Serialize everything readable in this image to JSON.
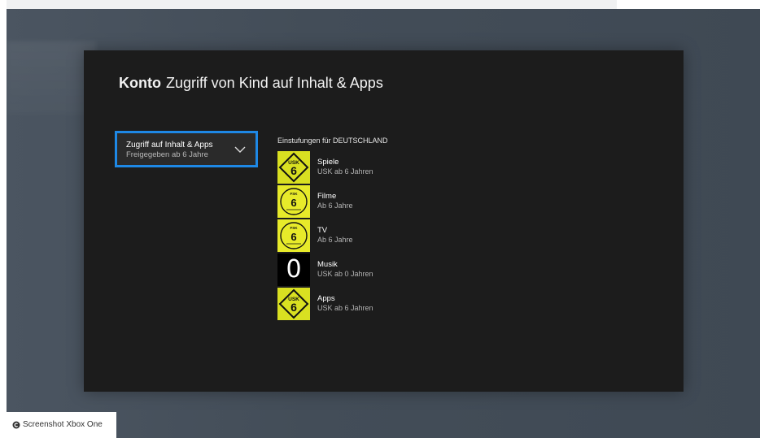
{
  "header": {
    "section": "Konto",
    "page_title": "Zugriff von Kind auf Inhalt & Apps"
  },
  "access_dropdown": {
    "label": "Zugriff auf Inhalt & Apps",
    "value": "Freigegeben ab 6 Jahre",
    "icon": "chevron-down-icon"
  },
  "ratings": {
    "heading": "Einstufungen für DEUTSCHLAND",
    "items": [
      {
        "category": "Spiele",
        "rating": "USK ab 6 Jahren",
        "badge": "usk",
        "badge_text": "USK",
        "badge_number": "6"
      },
      {
        "category": "Filme",
        "rating": "Ab 6 Jahre",
        "badge": "fsk",
        "badge_text": "FSK",
        "badge_number": "6"
      },
      {
        "category": "TV",
        "rating": "Ab 6 Jahre",
        "badge": "fsk",
        "badge_text": "FSK",
        "badge_number": "6"
      },
      {
        "category": "Musik",
        "rating": "USK ab 0 Jahren",
        "badge": "zero",
        "badge_number": "0"
      },
      {
        "category": "Apps",
        "rating": "USK ab 6 Jahren",
        "badge": "usk",
        "badge_text": "USK",
        "badge_number": "6"
      }
    ]
  },
  "caption": {
    "icon": "copyright-icon",
    "text": "Screenshot Xbox One"
  },
  "colors": {
    "focus_border": "#1e88e5",
    "usk_yellow": "#d9e021",
    "fsk_yellow": "#e7ea2a",
    "screen_bg": "#1c1c1c"
  }
}
